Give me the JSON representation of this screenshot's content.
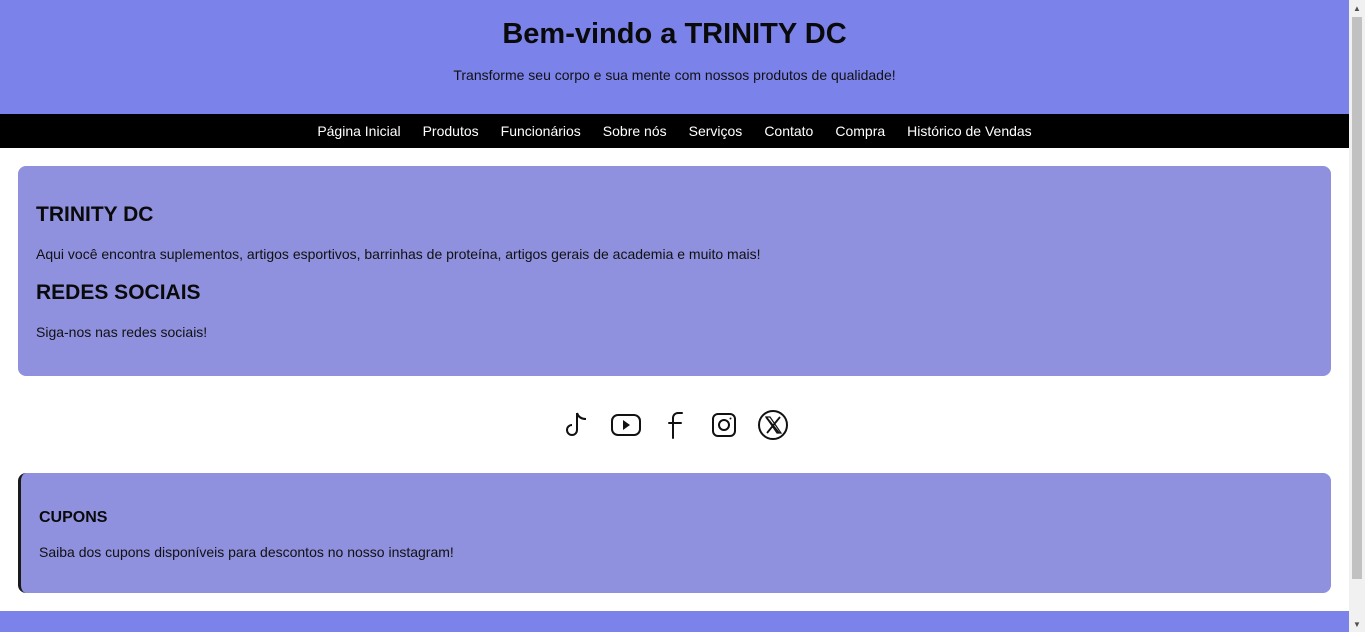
{
  "header": {
    "title": "Bem-vindo a TRINITY DC",
    "subtitle": "Transforme seu corpo e sua mente com nossos produtos de qualidade!"
  },
  "nav": {
    "items": [
      {
        "label": "Página Inicial"
      },
      {
        "label": "Produtos"
      },
      {
        "label": "Funcionários"
      },
      {
        "label": "Sobre nós"
      },
      {
        "label": "Serviços"
      },
      {
        "label": "Contato"
      },
      {
        "label": "Compra"
      },
      {
        "label": "Histórico de Vendas"
      }
    ]
  },
  "about": {
    "heading": "TRINITY DC",
    "text": "Aqui você encontra suplementos, artigos esportivos, barrinhas de proteína, artigos gerais de academia e muito mais!",
    "social_heading": "REDES SOCIAIS",
    "social_text": "Siga-nos nas redes sociais!"
  },
  "social": {
    "icons": [
      "tiktok-icon",
      "youtube-icon",
      "facebook-icon",
      "instagram-icon",
      "x-twitter-icon"
    ]
  },
  "coupons": {
    "heading": "CUPONS",
    "text": "Saiba dos cupons disponíveis para descontos no nosso instagram!"
  },
  "colors": {
    "header_bg": "#7b82ea",
    "nav_bg": "#000000",
    "card_bg": "#8f90de"
  }
}
